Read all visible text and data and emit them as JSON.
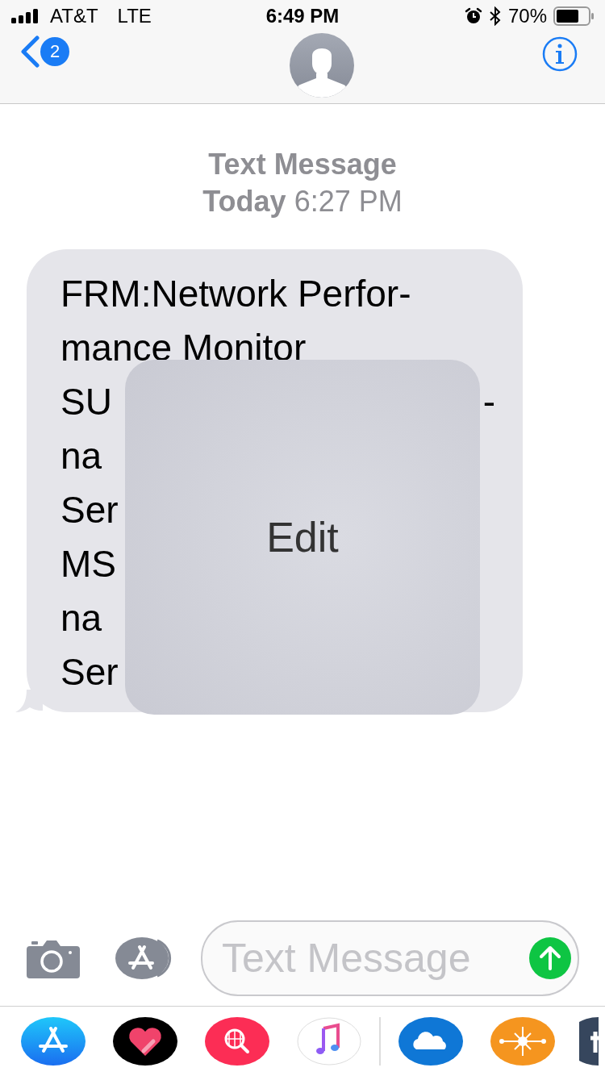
{
  "status_bar": {
    "carrier": "AT&T",
    "network": "LTE",
    "time": "6:49 PM",
    "battery": "70%"
  },
  "nav": {
    "back_badge": "2"
  },
  "thread_header": {
    "title": "Text Message",
    "timestamp": "**Today** 6:27 PM"
  },
  "message": {
    "lines": [
      {
        "text": "FRM:Network Perfor-"
      },
      {
        "text": "mance Monitor"
      },
      {
        "text": "SU",
        "trailing": "-"
      },
      {
        "text": "na"
      },
      {
        "text": "Ser"
      },
      {
        "text": "MS"
      },
      {
        "text": "na"
      },
      {
        "text": "Ser"
      }
    ],
    "overlay": {
      "label": "Edit"
    }
  },
  "composer": {
    "placeholder": "Text Message"
  }
}
